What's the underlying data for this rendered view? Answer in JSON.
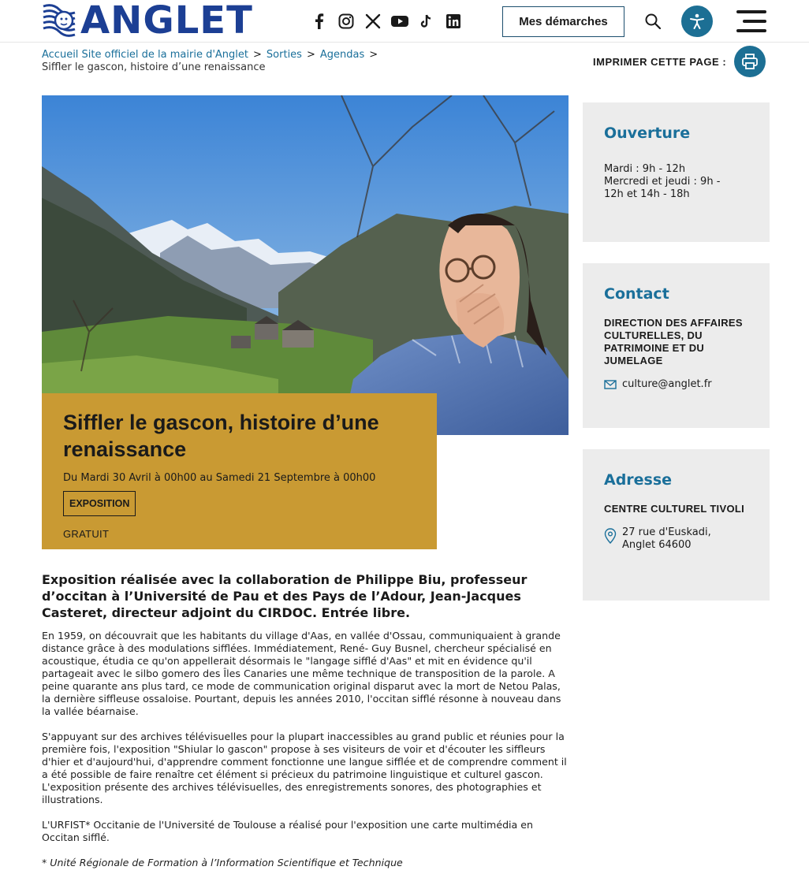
{
  "header": {
    "logo_text": "ANGLET",
    "socials": [
      "facebook-icon",
      "instagram-icon",
      "x-icon",
      "youtube-icon",
      "tiktok-icon",
      "linkedin-icon"
    ],
    "demarches_label": "Mes démarches"
  },
  "breadcrumb": {
    "items": [
      "Accueil Site officiel de la mairie d'Anglet",
      "Sorties",
      "Agendas"
    ],
    "separator": ">",
    "current": "Siffler le gascon, histoire d’une renaissance"
  },
  "print": {
    "label": "IMPRIMER CETTE PAGE :"
  },
  "event": {
    "title": "Siffler le gascon, histoire d’une renaissance",
    "dates": "Du Mardi 30 Avril à 00h00 au Samedi 21 Septembre à 00h00",
    "tag": "EXPOSITION",
    "price": "GRATUIT"
  },
  "content": {
    "lead": "Exposition réalisée avec la collaboration de Philippe Biu, professeur d’occitan à l’Université de Pau et des Pays de l’Adour, Jean-Jacques Casteret, directeur adjoint du CIRDOC. Entrée libre.",
    "paragraphs": [
      "En 1959, on découvrait que les habitants du village d'Aas, en vallée d'Ossau, communiquaient à grande distance grâce à des modulations sifflées. Immédiatement, René- Guy Busnel, chercheur spécialisé en acoustique, étudia ce qu'on appellerait désormais le \"langage sifflé d'Aas\" et mit en évidence qu'il partageait avec le silbo gomero des Îles Canaries une même technique de transposition de la parole. A peine quarante ans plus tard, ce mode de communication original disparut avec la mort de Netou Palas, la dernière siffleuse ossaloise. Pourtant, depuis les années 2010, l'occitan sifflé résonne à nouveau dans la vallée béarnaise.",
      "S'appuyant sur des archives télévisuelles pour la plupart inaccessibles au grand public et réunies pour la première fois, l'exposition \"Shiular lo gascon\" propose à ses visiteurs de voir et d'écouter les siffleurs d'hier et d'aujourd'hui, d'apprendre comment fonctionne une langue sifflée et de comprendre comment il a été possible de faire renaître cet élément si précieux du patrimoine linguistique et culturel gascon. L'exposition présente des archives télévisuelles, des enregistrements sonores, des photographies et illustrations.",
      "L'URFIST* Occitanie de l'Université de Toulouse a réalisé pour l'exposition une carte multimédia en Occitan sifflé."
    ],
    "note": "* Unité Régionale de Formation à l’Information Scientifique et Technique"
  },
  "sidebar": {
    "opening": {
      "title": "Ouverture",
      "line1": "Mardi : 9h - 12h",
      "line2": "Mercredi et jeudi : 9h -",
      "line3": "12h et 14h - 18h"
    },
    "contact": {
      "title": "Contact",
      "org": "DIRECTION DES AFFAIRES CULTURELLES, DU PATRIMOINE ET DU JUMELAGE",
      "email": "culture@anglet.fr"
    },
    "address": {
      "title": "Adresse",
      "place": "CENTRE CULTUREL TIVOLI",
      "street": "27 rue d'Euskadi,",
      "city": "Anglet 64600"
    }
  },
  "colors": {
    "brand_blue": "#1c3f94",
    "accent_teal": "#1c6f94",
    "card_gold": "#c99a33",
    "sidebar_bg": "#ececec"
  }
}
